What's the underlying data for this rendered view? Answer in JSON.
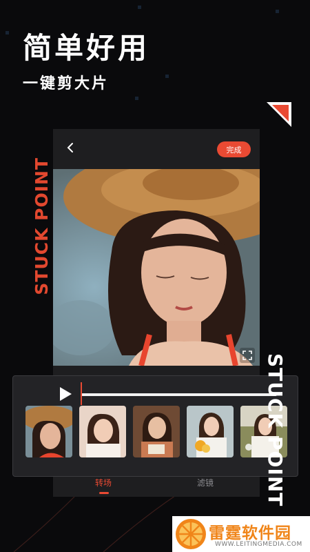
{
  "headline": "简单好用",
  "subheadline": "一键剪大片",
  "side_text_red": "STUCK POINT",
  "side_text_white": "STUCK POINT",
  "editor": {
    "done_label": "完成",
    "tabs": [
      {
        "label": "转场",
        "active": true
      },
      {
        "label": "滤镜",
        "active": false
      }
    ]
  },
  "timeline": {
    "progress": 0.0,
    "clips": [
      "clip-1",
      "clip-2",
      "clip-3",
      "clip-4",
      "clip-5"
    ]
  },
  "watermark": {
    "name": "雷霆软件园",
    "url": "WWW.LEITINGMEDIA.COM"
  },
  "colors": {
    "accent": "#e94a33",
    "background": "#0a0a0c",
    "panel": "#232326",
    "logo_orange": "#f08519"
  },
  "icons": [
    "back-icon",
    "fullscreen-icon",
    "play-icon",
    "orange-slice-logo-icon"
  ]
}
